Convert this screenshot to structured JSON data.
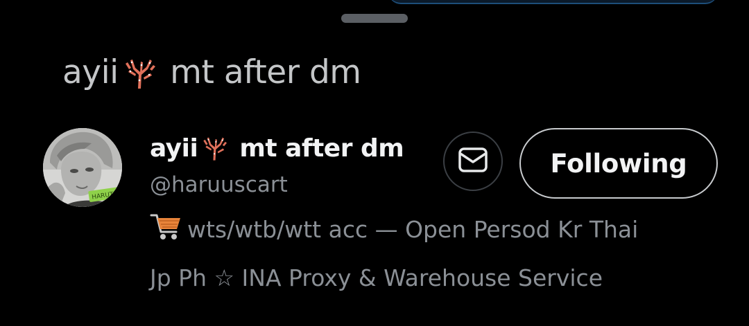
{
  "sheet": {
    "title_prefix": "ayii",
    "title_suffix": " mt after dm"
  },
  "profile": {
    "name_prefix": "ayii",
    "name_suffix": " mt after dm",
    "handle": "@haruuscart",
    "avatar_sticker_text": "HARUTO",
    "bio_line1": "wts/wtb/wtt acc — Open Persod Kr Thai",
    "bio_line2": "Jp Ph ☆ INA Proxy & Warehouse Service"
  },
  "actions": {
    "follow_label": "Following"
  },
  "icons": {
    "title_emoji": "coral-icon",
    "name_emoji": "coral-icon",
    "dm": "envelope-icon",
    "bio_emoji": "shopping-cart-icon"
  },
  "colors": {
    "background": "#000000",
    "text_primary": "#e7e9ea",
    "text_secondary": "#8b9096",
    "coral": "#e0705a",
    "cart": "#e8843a"
  }
}
